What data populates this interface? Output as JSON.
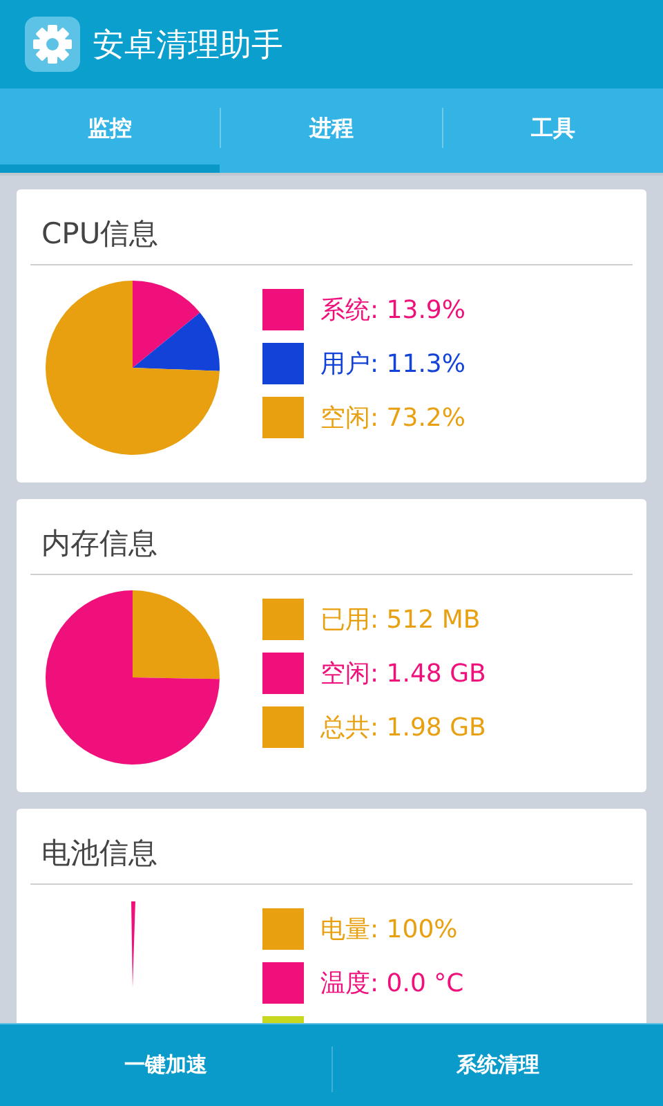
{
  "app_bar": {
    "title": "安卓清理助手"
  },
  "tabs": [
    {
      "label": "监控",
      "selected": true
    },
    {
      "label": "进程",
      "selected": false
    },
    {
      "label": "工具",
      "selected": false
    }
  ],
  "cards": [
    {
      "title": "CPU信息",
      "kind": "pie",
      "chart_data": {
        "type": "pie",
        "values": [
          14.1,
          11.5,
          74.4
        ]
      },
      "legend": [
        {
          "label": "系统: 13.9%",
          "color": "#f0107c"
        },
        {
          "label": "用户: 11.3%",
          "color": "#1242d8"
        },
        {
          "label": "空闲: 73.2%",
          "color": "#e8a010"
        }
      ]
    },
    {
      "title": "内存信息",
      "kind": "pie",
      "chart_data": {
        "type": "pie",
        "values": [
          25.3,
          74.7
        ]
      },
      "legend": [
        {
          "label": "已用: 512 MB",
          "color": "#e8a010"
        },
        {
          "label": "空闲: 1.48 GB",
          "color": "#f0107c"
        },
        {
          "label": "总共: 1.98 GB",
          "color": "#e8a010"
        }
      ]
    },
    {
      "title": "电池信息",
      "kind": "sliver",
      "legend": [
        {
          "label": "电量: 100%",
          "color": "#e8a010"
        },
        {
          "label": "温度: 0.0 °C",
          "color": "#f0107c"
        },
        {
          "color": "#c8d820"
        }
      ]
    }
  ],
  "bottom_bar": {
    "buttons": [
      "一键加速",
      "系统清理"
    ]
  }
}
